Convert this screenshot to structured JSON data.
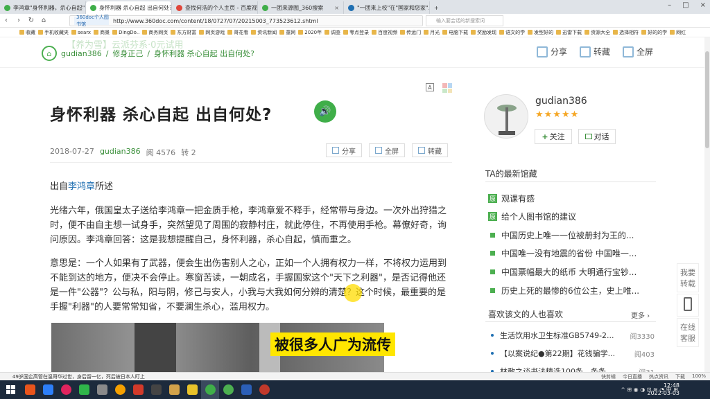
{
  "browser": {
    "tabs": [
      {
        "label": "李鸿章\"身怀利器，杀心自起\"告...",
        "color": "#3fae49"
      },
      {
        "label": "身怀利器 杀心自起 出自何处?",
        "color": "#3fae49"
      },
      {
        "label": "查找何浩的个人主页 - 百度视频",
        "color": "#e0463a"
      },
      {
        "label": "一团来源图_360搜索",
        "color": "#3fae49"
      },
      {
        "label": "\"一团来上校\"在\"国家和您家\"...",
        "color": "#1f6fb2"
      }
    ],
    "url": "http://www.360doc.com/content/18/0727/07/20215003_773523612.shtml",
    "url_badge": "360doc个人图书馆",
    "search_placeholder": "输入要会话的新搜索词",
    "bookmarks": [
      "收藏",
      "手机收藏夹",
      "searx",
      "商景",
      "DingDo..",
      "商务网页",
      "东方财富",
      "网页游戏",
      "哥花看",
      "资讯新闻",
      "童网",
      "2020年",
      "调查",
      "零点登录",
      "百度视频",
      "传运门",
      "月光",
      "电脑下载",
      "奖励发现",
      "语文的学",
      "发型好的",
      "迅雷下载",
      "资源大全",
      "选择相符",
      "好的的学",
      "网红"
    ]
  },
  "header": {
    "ghost_text": "【养为雪】云派芬系·0元试用",
    "home_icon": "home-icon",
    "breadcrumb": [
      "gudian386",
      "修身正己",
      "身怀利器 杀心自起 出自何处?"
    ],
    "actions": {
      "share": "分享",
      "collect": "转藏",
      "fullscreen": "全屏"
    }
  },
  "article": {
    "title": "身怀利器 杀心自起 出自何处?",
    "font_btn": "A",
    "date": "2018-07-27",
    "author": "gudian386",
    "reads": "阅 4576",
    "reposts": "转 2",
    "btn_share": "分享",
    "btn_fullscreen": "全屏",
    "btn_collect": "转藏",
    "intro_prefix": "出自",
    "intro_link": "李鸿章",
    "intro_suffix": "所述",
    "p1": "光绪六年，俄国皇太子送给李鸿章一把金质手枪，李鸿章爱不释手，经常带与身边。一次外出狩猎之时，便不由自主想一试身手，突然望见了周围的寂静村庄，就此停住，不再使用手枪。幕僚好奇，询问原因。李鸿章回答：这是我想提醒自己，身怀利器，杀心自起，慎而重之。",
    "p2": "意思是：一个人如果有了武器，便会生出伤害别人之心，正如一个人拥有权力一样，不将权力运用到不能到达的地方，便决不会停止。寒窗苦读，一朝成名，手握国家这个\"天下之利器\"，是否记得他还是一件\"公器\"？公与私，阳与阴，修己与安人，小我与大我如何分辨的清楚？这个时候，最重要的是手握\"利器\"的人要常常知省，不要澜生杀心，滥用权力。",
    "image_caption": "被很多人广为流传"
  },
  "sidebar": {
    "username": "gudian386",
    "stars": "★★★★★",
    "follow": "关注",
    "chat": "对话",
    "latest_title": "TA的最新馆藏",
    "latest": [
      {
        "badge": "原",
        "text": "观课有感"
      },
      {
        "badge": "原",
        "text": "给个人图书馆的建议"
      },
      {
        "badge": "",
        "text": "中国历史上唯一一位被册封为王的..."
      },
      {
        "badge": "",
        "text": "中国唯一没有地震的省份 中国唯一..."
      },
      {
        "badge": "",
        "text": "中国票幅最大的纸币 大明通行宝钞..."
      },
      {
        "badge": "",
        "text": "历史上死的最惨的6位公主，史上唯..."
      }
    ],
    "like_title": "喜欢该文的人也喜欢",
    "more": "更多",
    "liked": [
      {
        "text": "生活饮用水卫生标准GB5749-2...",
        "count": "阅3330"
      },
      {
        "text": "【以案说纪●第22期】花钱骗学...",
        "count": "阅403"
      },
      {
        "text": "林散之谈书法精选100条，条条...",
        "count": "阅31"
      }
    ],
    "float_collect": "我要转载",
    "float_service": "在线客服"
  },
  "statusbar": {
    "left": "49岁国企高管在温哥华过世，身后留一亿，死后被日本人盯上",
    "items": [
      "快剪辑",
      "今日直播",
      "热点资讯",
      "下载",
      "100%"
    ]
  },
  "taskbar": {
    "time": "12:48",
    "date": "2022-03-03"
  }
}
